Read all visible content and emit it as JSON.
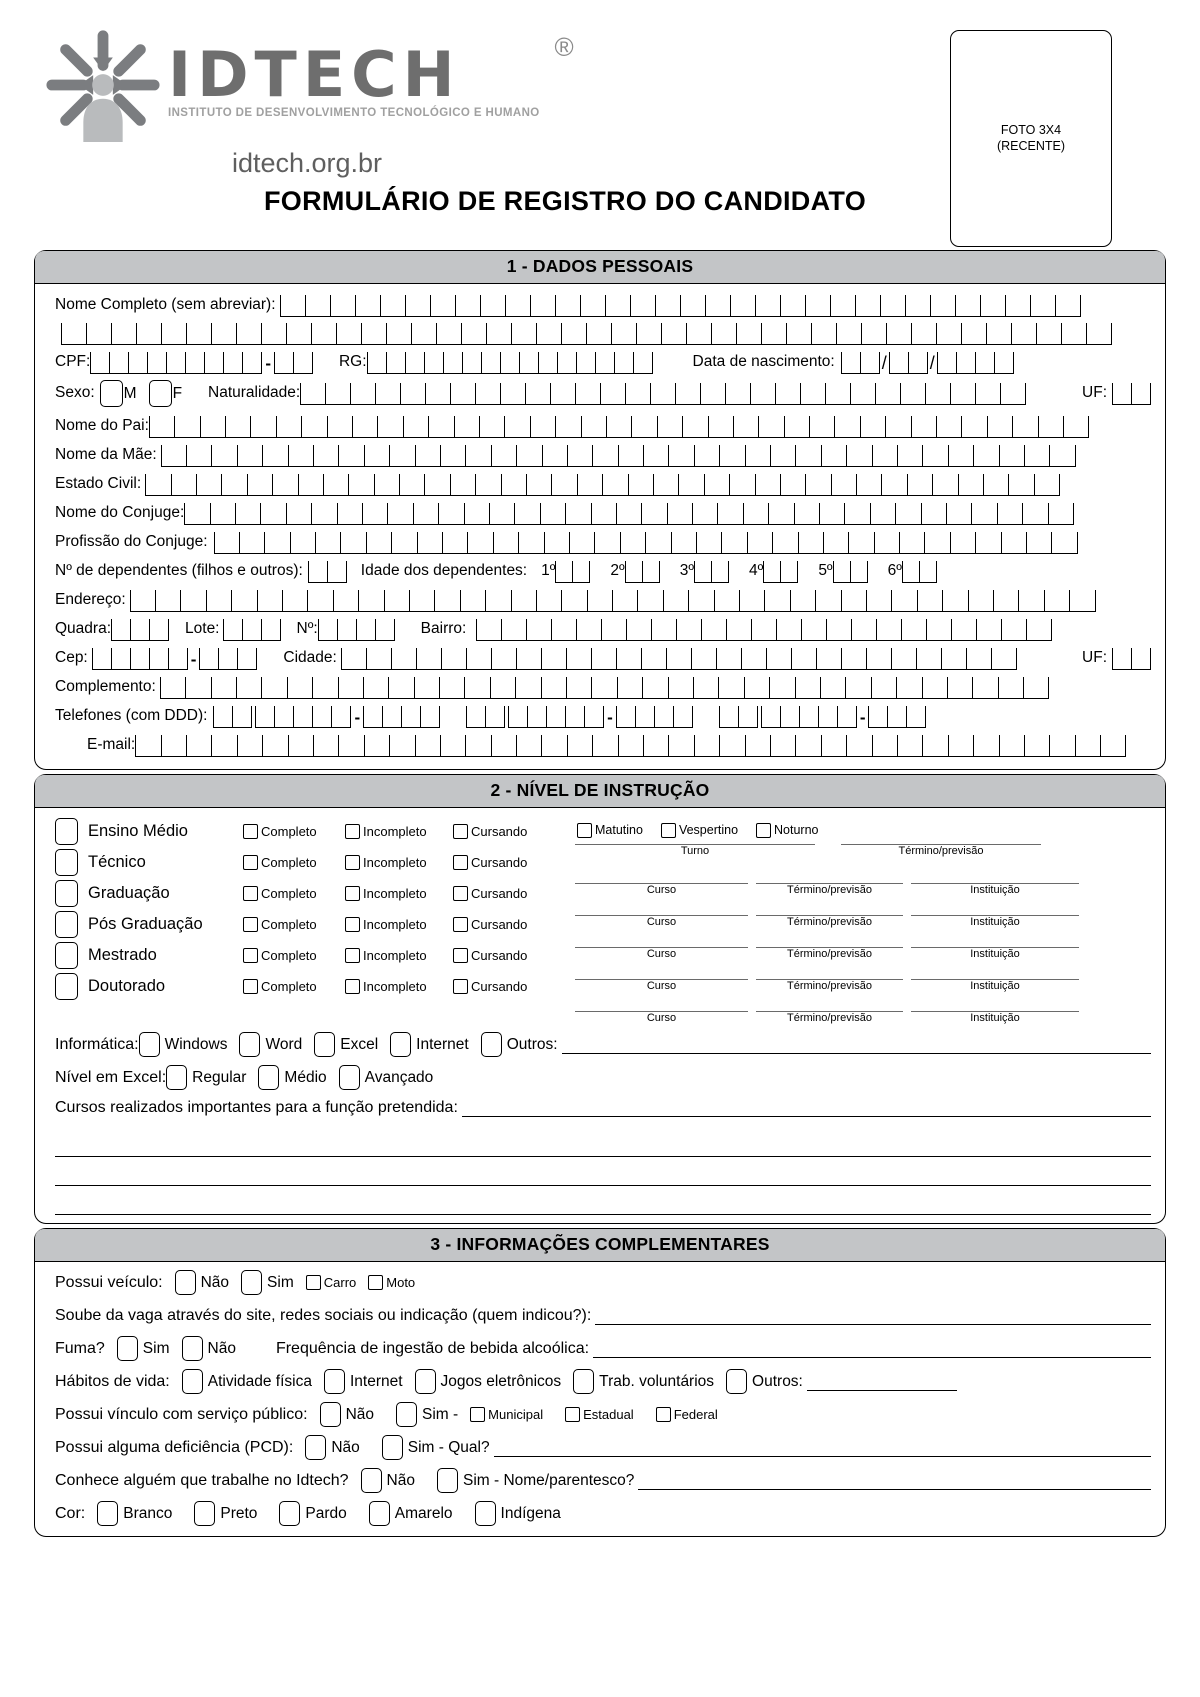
{
  "header": {
    "logo_word": "IDTECH",
    "logo_registered": "®",
    "logo_subtitle": "INSTITUTO DE DESENVOLVIMENTO TECNOLÓGICO E HUMANO",
    "logo_url": "idtech.org.br",
    "form_title": "FORMULÁRIO DE REGISTRO DO CANDIDATO",
    "photo_line1": "FOTO 3X4",
    "photo_line2": "(RECENTE)"
  },
  "section1": {
    "title": "1 - DADOS PESSOAIS",
    "labels": {
      "nome_completo": "Nome Completo (sem abreviar):",
      "cpf": "CPF:",
      "rg": "RG:",
      "data_nascimento": "Data de nascimento:",
      "sexo": "Sexo:",
      "sexo_m": "M",
      "sexo_f": "F",
      "naturalidade": "Naturalidade:",
      "uf": "UF:",
      "nome_pai": "Nome do Pai:",
      "nome_mae": "Nome da Mãe:",
      "estado_civil": "Estado Civil:",
      "nome_conjuge": "Nome do Conjuge:",
      "profissao_conjuge": "Profissão do Conjuge:",
      "n_dependentes": "Nº de dependentes (filhos e outros):",
      "idade_dependentes": "Idade dos dependentes:",
      "dep1": "1º",
      "dep2": "2º",
      "dep3": "3º",
      "dep4": "4º",
      "dep5": "5º",
      "dep6": "6º",
      "endereco": "Endereço:",
      "quadra": "Quadra:",
      "lote": "Lote:",
      "numero": "Nº:",
      "bairro": "Bairro:",
      "cep": "Cep:",
      "cidade": "Cidade:",
      "uf2": "UF:",
      "complemento": "Complemento:",
      "telefones": "Telefones (com DDD):",
      "email": "E-mail:"
    }
  },
  "section2": {
    "title": "2 - NÍVEL DE INSTRUÇÃO",
    "levels": [
      {
        "name": "Ensino Médio"
      },
      {
        "name": "Técnico"
      },
      {
        "name": "Graduação"
      },
      {
        "name": "Pós Graduação"
      },
      {
        "name": "Mestrado"
      },
      {
        "name": "Doutorado"
      }
    ],
    "status": {
      "completo": "Completo",
      "incompleto": "Incompleto",
      "cursando": "Cursando"
    },
    "turno": {
      "matutino": "Matutino",
      "vespertino": "Vespertino",
      "noturno": "Noturno",
      "caption": "Turno",
      "termino_caption": "Término/previsão"
    },
    "captions": {
      "curso": "Curso",
      "termino": "Término/previsão",
      "instituicao": "Instituição"
    },
    "informatica": {
      "label": "Informática:",
      "options": [
        "Windows",
        "Word",
        "Excel",
        "Internet"
      ],
      "outros": "Outros:"
    },
    "excel": {
      "label": "Nível em Excel:",
      "options": [
        "Regular",
        "Médio",
        "Avançado"
      ]
    },
    "cursos_realizados": "Cursos realizados importantes para a função pretendida:"
  },
  "section3": {
    "title": "3 - INFORMAÇÕES COMPLEMENTARES",
    "veiculo": {
      "label": "Possui veículo:",
      "nao": "Não",
      "sim": "Sim",
      "carro": "Carro",
      "moto": "Moto"
    },
    "soube_vaga": "Soube da vaga através do site, redes sociais ou indicação (quem indicou?):",
    "fuma": {
      "label": "Fuma?",
      "sim": "Sim",
      "nao": "Não"
    },
    "bebida": "Frequência de ingestão de bebida alcoólica:",
    "habitos": {
      "label": "Hábitos de vida:",
      "options": [
        "Atividade física",
        "Internet",
        "Jogos eletrônicos",
        "Trab. voluntários"
      ],
      "outros": "Outros:"
    },
    "vinculo": {
      "label": "Possui vínculo com serviço público:",
      "nao": "Não",
      "sim": "Sim -",
      "municipal": "Municipal",
      "estadual": "Estadual",
      "federal": "Federal"
    },
    "deficiencia": {
      "label": "Possui alguma deficiência (PCD):",
      "nao": "Não",
      "sim": "Sim - Qual?"
    },
    "conhece": {
      "label": "Conhece alguém que trabalhe no Idtech?",
      "nao": "Não",
      "sim": "Sim - Nome/parentesco?"
    },
    "cor": {
      "label": "Cor:",
      "options": [
        "Branco",
        "Preto",
        "Pardo",
        "Amarelo",
        "Indígena"
      ]
    }
  },
  "colors": {
    "section_header_bg": "#c3c5c7",
    "logo_gray": "#6e6e6e",
    "logo_light_gray": "#a8a8a8",
    "border": "#000000"
  }
}
